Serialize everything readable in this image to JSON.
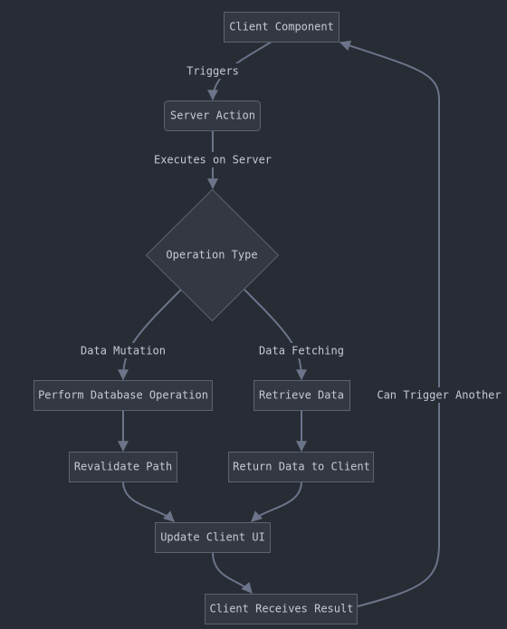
{
  "nodes": {
    "client_component": "Client Component",
    "server_action": "Server Action",
    "operation_type": "Operation Type",
    "perform_db": "Perform Database Operation",
    "retrieve_data": "Retrieve Data",
    "revalidate_path": "Revalidate Path",
    "return_data": "Return Data to Client",
    "update_ui": "Update Client UI",
    "client_receives": "Client Receives Result"
  },
  "edges": {
    "triggers": "Triggers",
    "executes": "Executes on Server",
    "mutation": "Data Mutation",
    "fetching": "Data Fetching",
    "can_trigger": "Can Trigger Another"
  },
  "colors": {
    "background": "#282c34",
    "node_fill": "#343842",
    "node_border": "#5c6370",
    "edge": "#6b7489",
    "text": "#c5cad3"
  }
}
